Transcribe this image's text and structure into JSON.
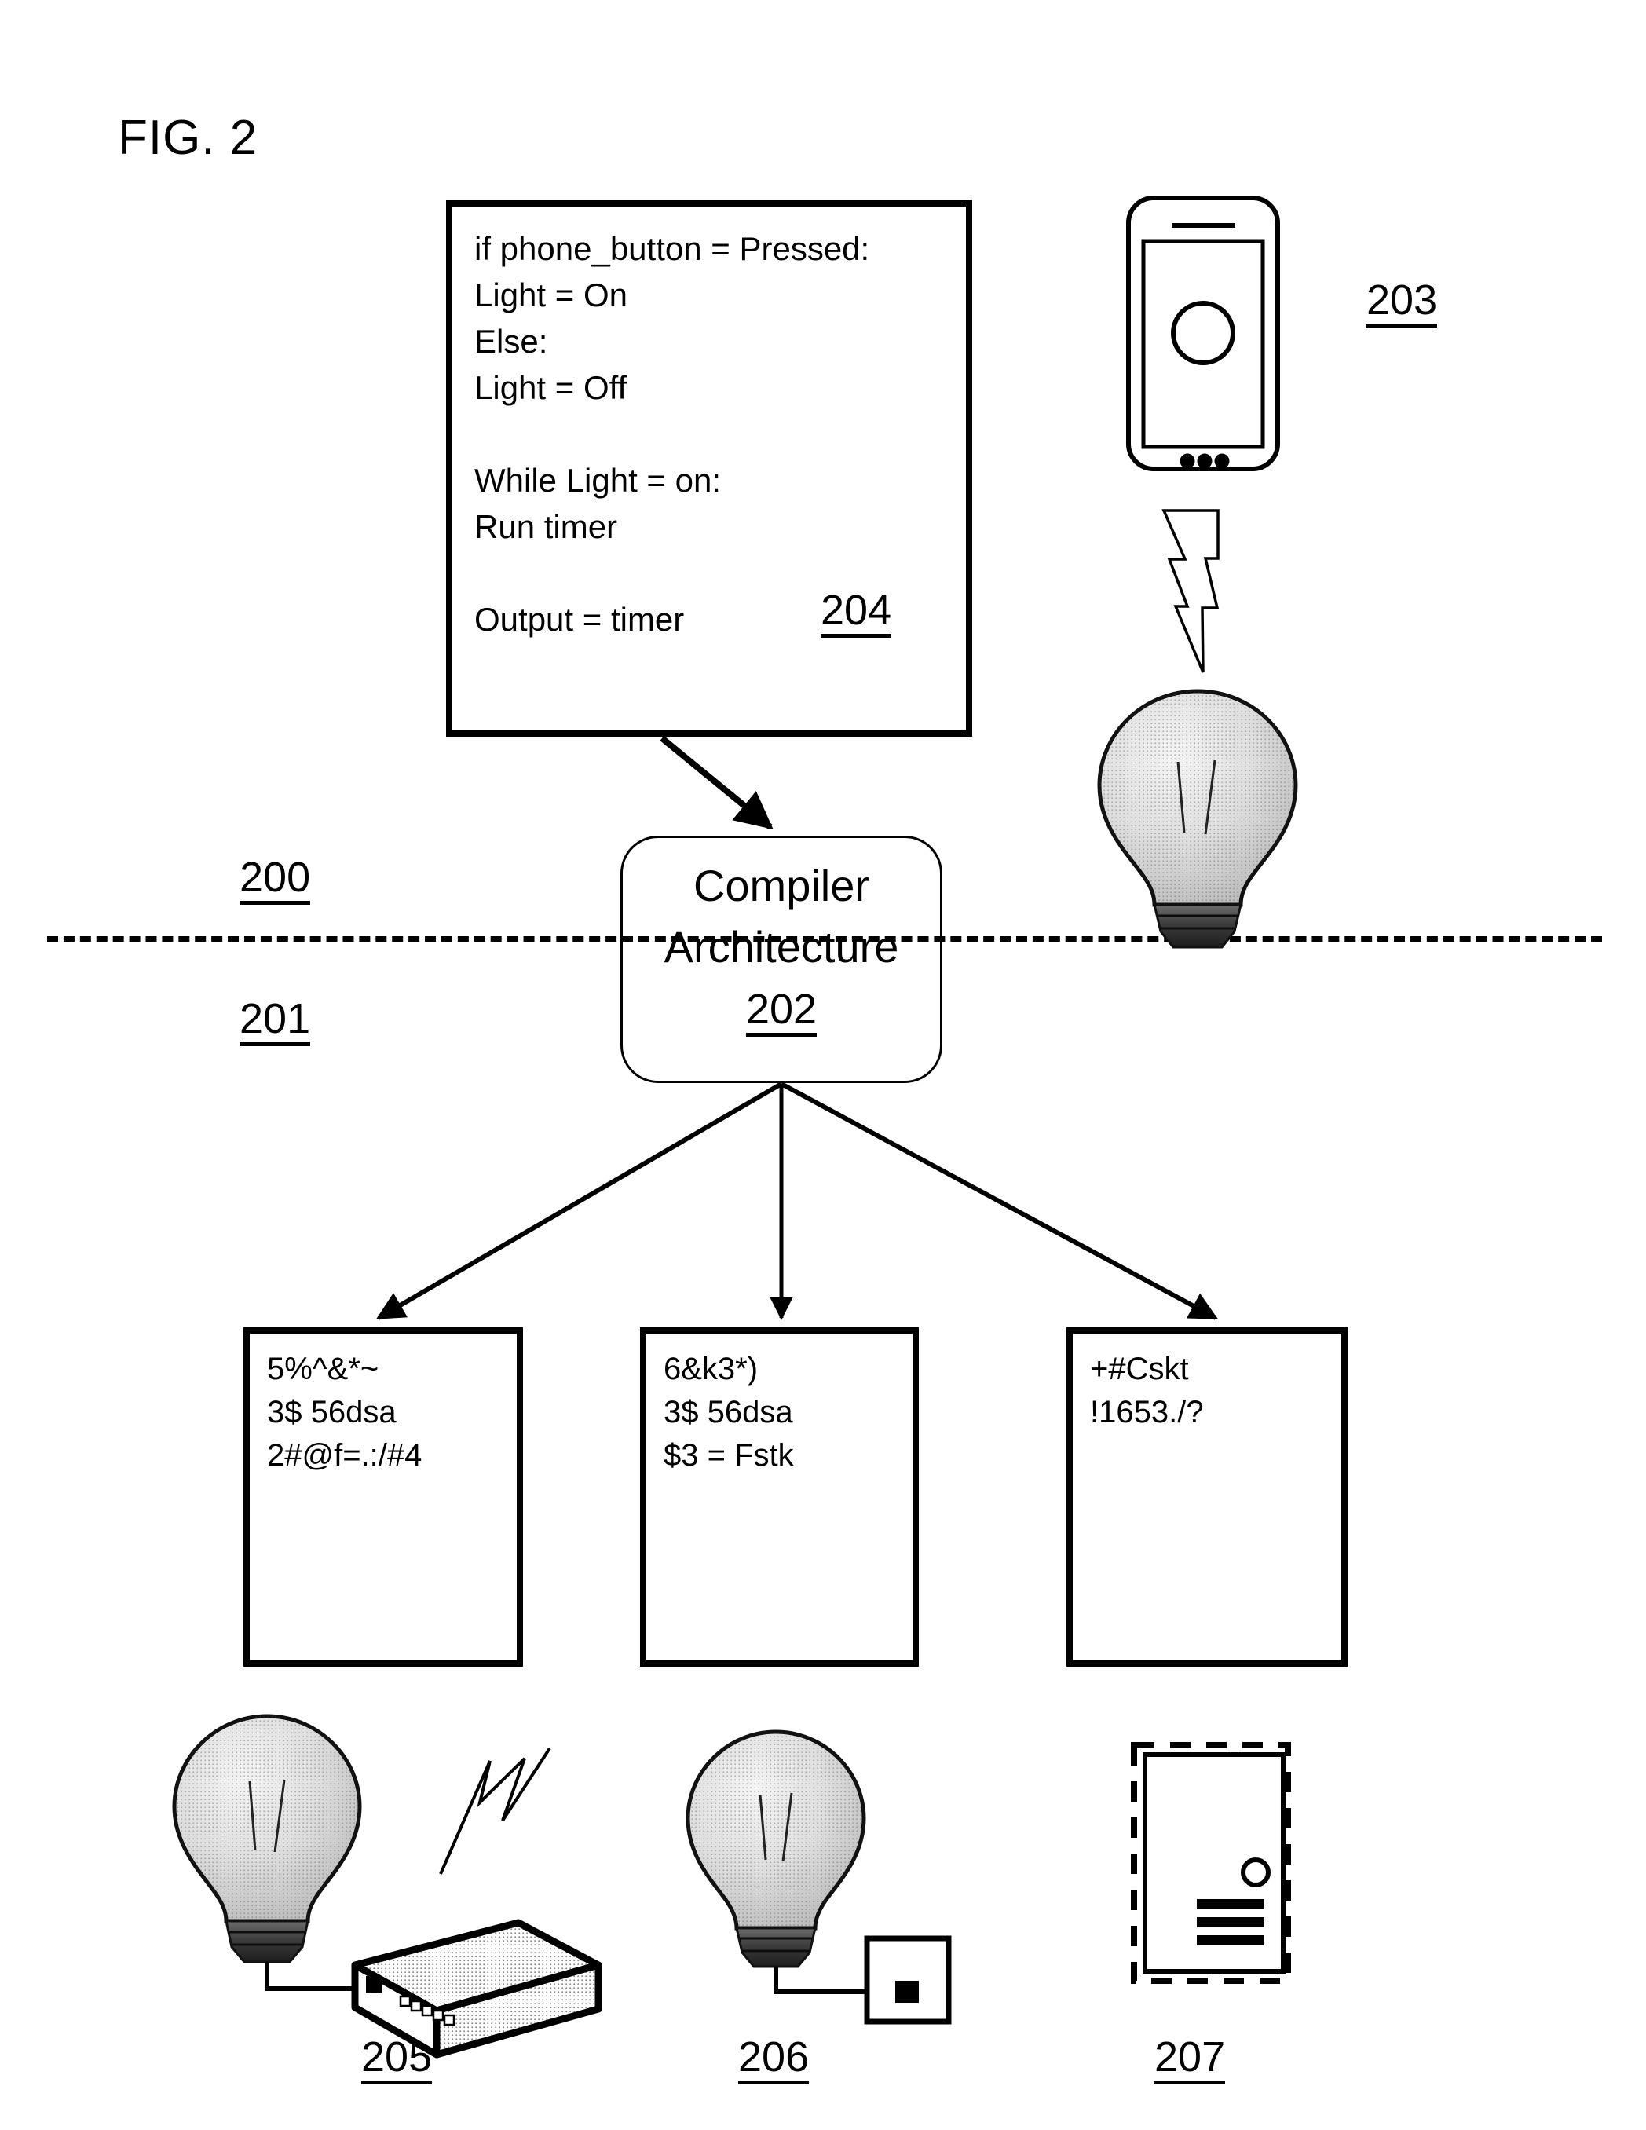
{
  "figure": {
    "title": "FIG. 2"
  },
  "source_code_block": {
    "ref": "204",
    "lines": [
      "if phone_button = Pressed:",
      "Light = On",
      "Else:",
      "Light = Off",
      "",
      "While Light = on:",
      "Run timer",
      "",
      "Output = timer"
    ],
    "text": "if phone_button = Pressed:\nLight = On\nElse:\nLight = Off\n\nWhile Light = on:\nRun timer\n\nOutput = timer"
  },
  "phone": {
    "ref": "203",
    "icon": "smartphone-icon"
  },
  "compiler": {
    "line1": "Compiler",
    "line2": "Architecture",
    "ref": "202"
  },
  "regions": {
    "upper_ref": "200",
    "lower_ref": "201"
  },
  "outputs": [
    {
      "ref_index": "1",
      "lines": [
        "5%^&*~",
        "3$ 56dsa",
        "2#@f=.:/#4"
      ],
      "text": "5%^&*~\n3$ 56dsa\n2#@f=.:/#4"
    },
    {
      "ref_index": "2",
      "lines": [
        "6&k3*)",
        "3$ 56dsa",
        "$3 = Fstk"
      ],
      "text": "6&k3*)\n3$ 56dsa\n$3 = Fstk"
    },
    {
      "ref_index": "3",
      "lines": [
        "+#Cskt",
        "!1653./?"
      ],
      "text": "+#Cskt\n!1653./?"
    }
  ],
  "devices": [
    {
      "ref": "205",
      "icon": "bulb-with-router-icon"
    },
    {
      "ref": "206",
      "icon": "bulb-with-switch-icon"
    },
    {
      "ref": "207",
      "icon": "tablet-dashed-icon"
    }
  ],
  "colors": {
    "ink": "#000000",
    "paper": "#ffffff",
    "bulb_glass": "#d8d8d8",
    "bulb_base": "#4a4a4a"
  }
}
